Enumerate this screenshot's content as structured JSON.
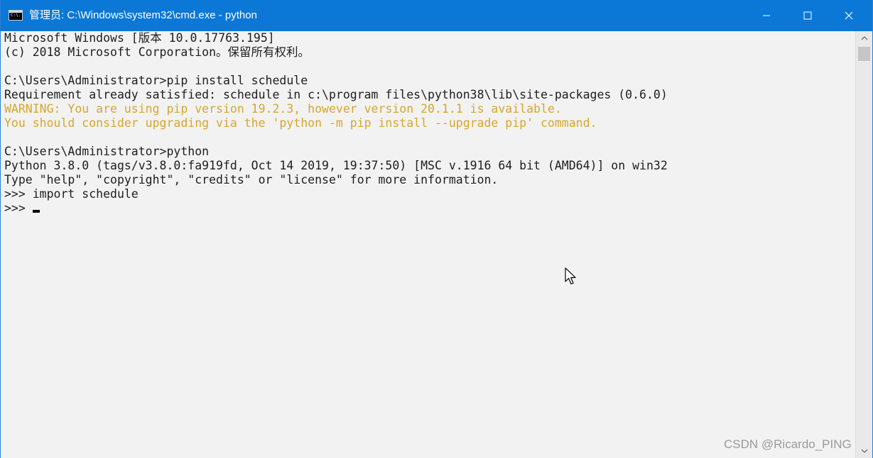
{
  "window": {
    "title": "管理员: C:\\Windows\\system32\\cmd.exe - python",
    "icon": "cmd-icon",
    "icon_text": "C:\\.",
    "controls": [
      "minimize-icon",
      "maximize-icon",
      "close-icon"
    ]
  },
  "console": {
    "lines": [
      {
        "text": "Microsoft Windows [版本 10.0.17763.195]",
        "style": "normal"
      },
      {
        "text": "(c) 2018 Microsoft Corporation。保留所有权利。",
        "style": "normal"
      },
      {
        "text": "",
        "style": "normal"
      },
      {
        "text": "C:\\Users\\Administrator>pip install schedule",
        "style": "normal"
      },
      {
        "text": "Requirement already satisfied: schedule in c:\\program files\\python38\\lib\\site-packages (0.6.0)",
        "style": "normal"
      },
      {
        "text": "WARNING: You are using pip version 19.2.3, however version 20.1.1 is available.",
        "style": "warning"
      },
      {
        "text": "You should consider upgrading via the 'python -m pip install --upgrade pip' command.",
        "style": "warning"
      },
      {
        "text": "",
        "style": "normal"
      },
      {
        "text": "C:\\Users\\Administrator>python",
        "style": "normal"
      },
      {
        "text": "Python 3.8.0 (tags/v3.8.0:fa919fd, Oct 14 2019, 19:37:50) [MSC v.1916 64 bit (AMD64)] on win32",
        "style": "normal"
      },
      {
        "text": "Type \"help\", \"copyright\", \"credits\" or \"license\" for more information.",
        "style": "normal"
      },
      {
        "text": ">>> import schedule",
        "style": "normal"
      },
      {
        "text": ">>> ",
        "style": "normal"
      }
    ]
  },
  "watermark": "CSDN @Ricardo_PING",
  "colors": {
    "titlebar": "#0b78d7",
    "console_bg": "#f2f2f2",
    "console_text": "#1e1e1e",
    "warning_text": "#d6a72a"
  }
}
